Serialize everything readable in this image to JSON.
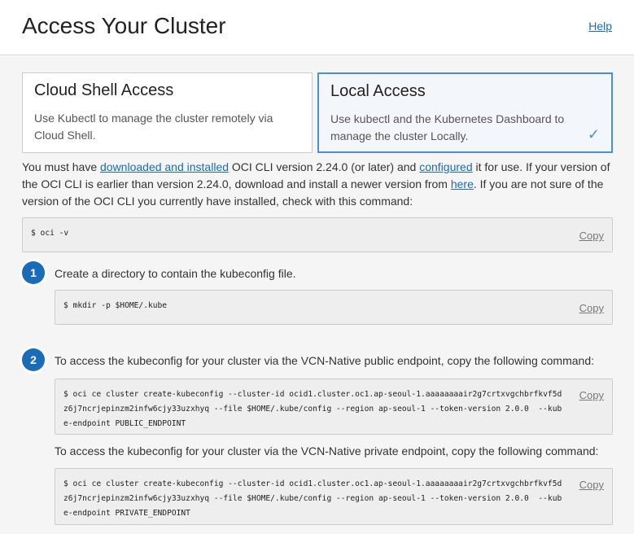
{
  "header": {
    "title": "Access Your Cluster",
    "help": "Help"
  },
  "cards": [
    {
      "title": "Cloud Shell Access",
      "desc": "Use Kubectl to manage the cluster remotely via Cloud Shell.",
      "selected": false
    },
    {
      "title": "Local Access",
      "desc": "Use kubectl and the Kubernetes Dashboard to manage the cluster Locally.",
      "selected": true,
      "check": "✓"
    }
  ],
  "intro": {
    "t1": "You must have ",
    "link1": "downloaded and installed",
    "t2": " OCI CLI version 2.24.0 (or later) and ",
    "link2": "configured",
    "t3": " it for use. If your version of the OCI CLI is earlier than version 2.24.0, download and install a newer version from ",
    "link3": "here",
    "t4": ". If you are not sure of the version of the OCI CLI you currently have installed, check with this command:"
  },
  "copy_label": "Copy",
  "code0": "$ oci -v",
  "steps": [
    {
      "num": "1",
      "text": "Create a directory to contain the kubeconfig file.",
      "code": "$ mkdir -p $HOME/.kube"
    },
    {
      "num": "2",
      "text": "To access the kubeconfig for your cluster via the VCN-Native public endpoint, copy the following command:",
      "code": "$ oci ce cluster create-kubeconfig --cluster-id ocid1.cluster.oc1.ap-seoul-1.aaaaaaaair2g7crtxvgchbrfkvf5dz6j7ncrjepinzm2infw6cjy33uzxhyq --file $HOME/.kube/config --region ap-seoul-1 --token-version 2.0.0  --kube-endpoint PUBLIC_ENDPOINT",
      "text2": "To access the kubeconfig for your cluster via the VCN-Native private endpoint, copy the following command:",
      "code2": "$ oci ce cluster create-kubeconfig --cluster-id ocid1.cluster.oc1.ap-seoul-1.aaaaaaaair2g7crtxvgchbrfkvf5dz6j7ncrjepinzm2infw6cjy33uzxhyq --file $HOME/.kube/config --region ap-seoul-1 --token-version 2.0.0  --kube-endpoint PRIVATE_ENDPOINT"
    }
  ]
}
